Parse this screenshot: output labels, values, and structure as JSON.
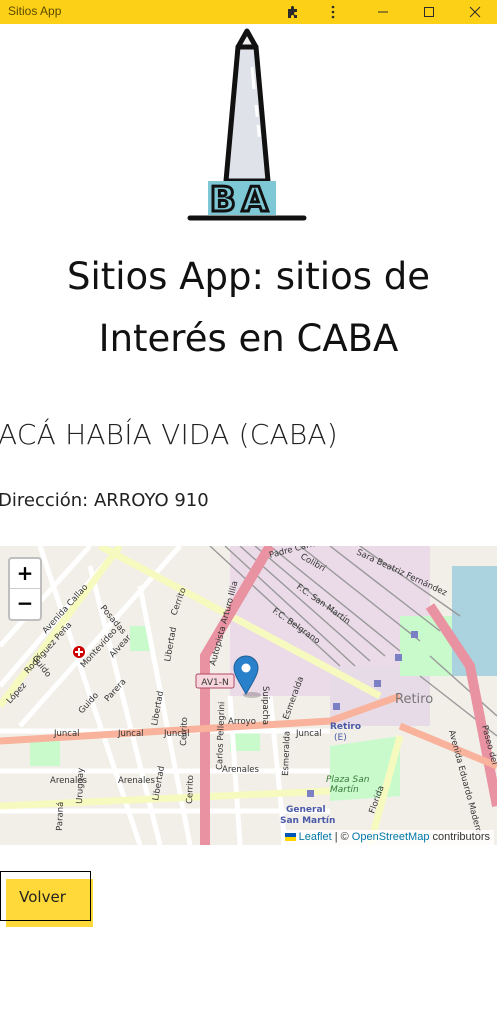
{
  "window": {
    "title": "Sitios App"
  },
  "titlebar_icons": [
    "extensions-icon",
    "more-vert-icon",
    "minimize-icon",
    "maximize-icon",
    "close-icon"
  ],
  "logo": {
    "text": "BA"
  },
  "page": {
    "heading_line1": "Sitios App: sitios de",
    "heading_line2": "Interés en CABA",
    "site_name": "ACÁ HABÍA VIDA (CABA)",
    "address": "Dirección: ARROYO 910"
  },
  "map": {
    "zoom_in": "+",
    "zoom_out": "−",
    "attribution_leaflet": "Leaflet",
    "attribution_sep": "| ©",
    "attribution_osm": "OpenStreetMap",
    "attribution_contrib": "contributors",
    "labels": {
      "av_callao": "Avenida Callao",
      "posadas": "Posadas",
      "alvear": "Alvear",
      "guido": "Guido",
      "rodriguez_pena": "Rodríguez Peña",
      "montevideo": "Montevideo",
      "parera": "Parera",
      "libertad": "Libertad",
      "cerrito": "Cerrito",
      "autopista": "Autopista Arturo Illia",
      "av1n": "AV1-N",
      "arroyo": "Arroyo",
      "suipacha": "Suipacha",
      "esmeralda": "Esmeralda",
      "juncal": "Juncal",
      "arenales": "Arenales",
      "carlos_pellegrini": "Carlos Pellegrini",
      "uruguay": "Uruguay",
      "parana": "Paraná",
      "retiro": "Retiro",
      "retiro_e": "Retiro (E)",
      "plaza_san_martin": "Plaza San Martín",
      "general_san_martin": "General San Martín",
      "florida": "Florida",
      "av_eduardo_madero": "Avenida Eduardo Madero",
      "paseo_del": "Paseo del",
      "fc_san_martin": "F.C. San Martín",
      "fc_belgrano": "F.C. Belgrano",
      "mugica": "Padre Carlos Mugica",
      "sara": "Sara Beatriz Fernández",
      "colibri": "Colibrí",
      "lopez": "López"
    }
  },
  "back_button": {
    "label": "Volver"
  },
  "colors": {
    "titlebar": "#fcd016",
    "button": "#ffd93a",
    "marker": "#2a81cb",
    "motorway": "#e892a2"
  }
}
